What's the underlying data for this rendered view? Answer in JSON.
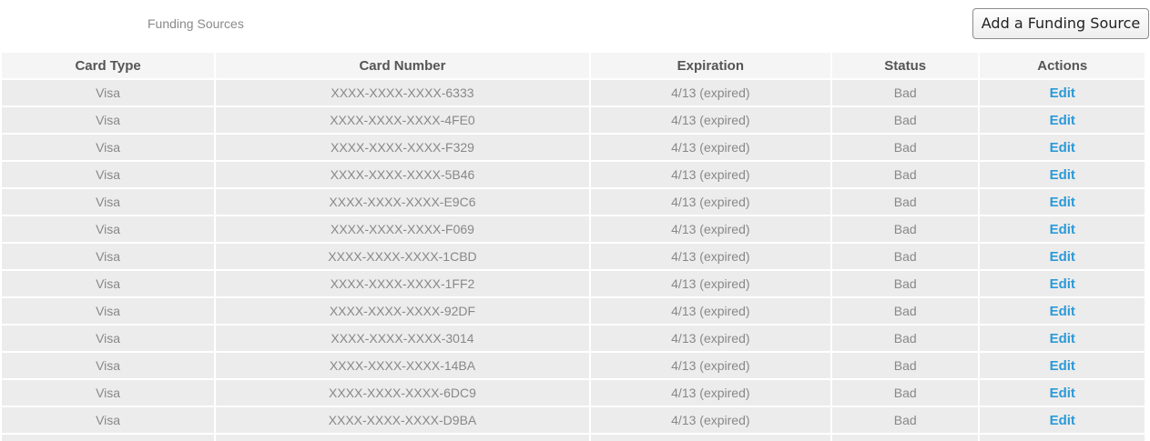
{
  "header": {
    "title": "Funding Sources",
    "add_button_label": "Add a Funding Source"
  },
  "table": {
    "columns": [
      "Card Type",
      "Card Number",
      "Expiration",
      "Status",
      "Actions"
    ],
    "rows": [
      {
        "card_type": "Visa",
        "card_number": "XXXX-XXXX-XXXX-6333",
        "expiration": "4/13 (expired)",
        "status": "Bad",
        "action": "Edit"
      },
      {
        "card_type": "Visa",
        "card_number": "XXXX-XXXX-XXXX-4FE0",
        "expiration": "4/13 (expired)",
        "status": "Bad",
        "action": "Edit"
      },
      {
        "card_type": "Visa",
        "card_number": "XXXX-XXXX-XXXX-F329",
        "expiration": "4/13 (expired)",
        "status": "Bad",
        "action": "Edit"
      },
      {
        "card_type": "Visa",
        "card_number": "XXXX-XXXX-XXXX-5B46",
        "expiration": "4/13 (expired)",
        "status": "Bad",
        "action": "Edit"
      },
      {
        "card_type": "Visa",
        "card_number": "XXXX-XXXX-XXXX-E9C6",
        "expiration": "4/13 (expired)",
        "status": "Bad",
        "action": "Edit"
      },
      {
        "card_type": "Visa",
        "card_number": "XXXX-XXXX-XXXX-F069",
        "expiration": "4/13 (expired)",
        "status": "Bad",
        "action": "Edit"
      },
      {
        "card_type": "Visa",
        "card_number": "XXXX-XXXX-XXXX-1CBD",
        "expiration": "4/13 (expired)",
        "status": "Bad",
        "action": "Edit"
      },
      {
        "card_type": "Visa",
        "card_number": "XXXX-XXXX-XXXX-1FF2",
        "expiration": "4/13 (expired)",
        "status": "Bad",
        "action": "Edit"
      },
      {
        "card_type": "Visa",
        "card_number": "XXXX-XXXX-XXXX-92DF",
        "expiration": "4/13 (expired)",
        "status": "Bad",
        "action": "Edit"
      },
      {
        "card_type": "Visa",
        "card_number": "XXXX-XXXX-XXXX-3014",
        "expiration": "4/13 (expired)",
        "status": "Bad",
        "action": "Edit"
      },
      {
        "card_type": "Visa",
        "card_number": "XXXX-XXXX-XXXX-14BA",
        "expiration": "4/13 (expired)",
        "status": "Bad",
        "action": "Edit"
      },
      {
        "card_type": "Visa",
        "card_number": "XXXX-XXXX-XXXX-6DC9",
        "expiration": "4/13 (expired)",
        "status": "Bad",
        "action": "Edit"
      },
      {
        "card_type": "Visa",
        "card_number": "XXXX-XXXX-XXXX-D9BA",
        "expiration": "4/13 (expired)",
        "status": "Bad",
        "action": "Edit"
      },
      {
        "card_type": "",
        "card_number": "",
        "expiration": "",
        "status": "",
        "action": ""
      }
    ]
  },
  "colors": {
    "header_bg": "#f5f5f5",
    "row_bg": "#ececec",
    "link": "#2a9ad8",
    "muted_text": "#888888"
  }
}
